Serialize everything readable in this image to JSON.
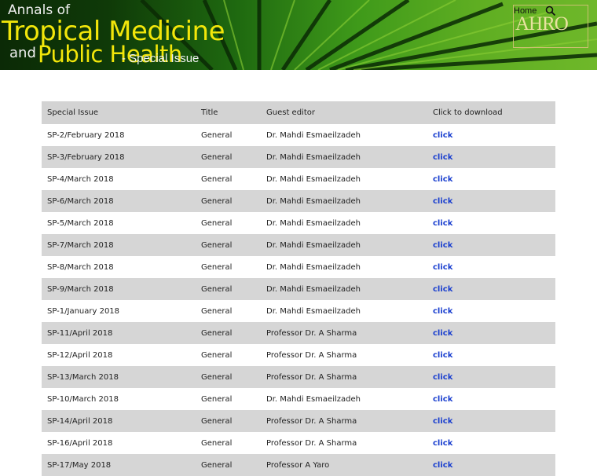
{
  "banner": {
    "line1": "Annals of",
    "line2": "Tropical Medicine",
    "line3a": "and",
    "line3b": "Public Health",
    "suffix": "- Special Issue",
    "home": "Home",
    "logo": "AHRO"
  },
  "table": {
    "headers": [
      "Special Issue",
      "Title",
      "Guest editor",
      "Click to download"
    ],
    "rows": [
      {
        "issue": "SP-2/February 2018",
        "title": "General",
        "editor": "Dr. Mahdi Esmaeilzadeh",
        "link": "click"
      },
      {
        "issue": "SP-3/February 2018",
        "title": "General",
        "editor": "Dr. Mahdi Esmaeilzadeh",
        "link": "click"
      },
      {
        "issue": "SP-4/March 2018",
        "title": "General",
        "editor": "Dr. Mahdi Esmaeilzadeh",
        "link": "click"
      },
      {
        "issue": "SP-6/March 2018",
        "title": "General",
        "editor": "Dr. Mahdi Esmaeilzadeh",
        "link": "click"
      },
      {
        "issue": "SP-5/March 2018",
        "title": "General",
        "editor": "Dr. Mahdi Esmaeilzadeh",
        "link": "click"
      },
      {
        "issue": "SP-7/March 2018",
        "title": "General",
        "editor": "Dr. Mahdi Esmaeilzadeh",
        "link": "click"
      },
      {
        "issue": "SP-8/March 2018",
        "title": "General",
        "editor": "Dr. Mahdi Esmaeilzadeh",
        "link": "click"
      },
      {
        "issue": "SP-9/March 2018",
        "title": "General",
        "editor": "Dr. Mahdi Esmaeilzadeh",
        "link": "click"
      },
      {
        "issue": "SP-1/January 2018",
        "title": "General",
        "editor": "Dr. Mahdi Esmaeilzadeh",
        "link": "click"
      },
      {
        "issue": "SP-11/April 2018",
        "title": "General",
        "editor": "Professor Dr. A Sharma",
        "link": "click"
      },
      {
        "issue": "SP-12/April 2018",
        "title": "General",
        "editor": "Professor Dr. A Sharma",
        "link": "click"
      },
      {
        "issue": "SP-13/March 2018",
        "title": "General",
        "editor": "Professor Dr. A Sharma",
        "link": "click"
      },
      {
        "issue": "SP-10/March 2018",
        "title": "General",
        "editor": "Dr. Mahdi Esmaeilzadeh",
        "link": "click"
      },
      {
        "issue": "SP-14/April 2018",
        "title": "General",
        "editor": "Professor Dr. A Sharma",
        "link": "click"
      },
      {
        "issue": "SP-16/April 2018",
        "title": "General",
        "editor": "Professor Dr. A Sharma",
        "link": "click"
      },
      {
        "issue": "SP-17/May 2018",
        "title": "General",
        "editor": "Professor A Yaro",
        "link": "click"
      }
    ]
  }
}
